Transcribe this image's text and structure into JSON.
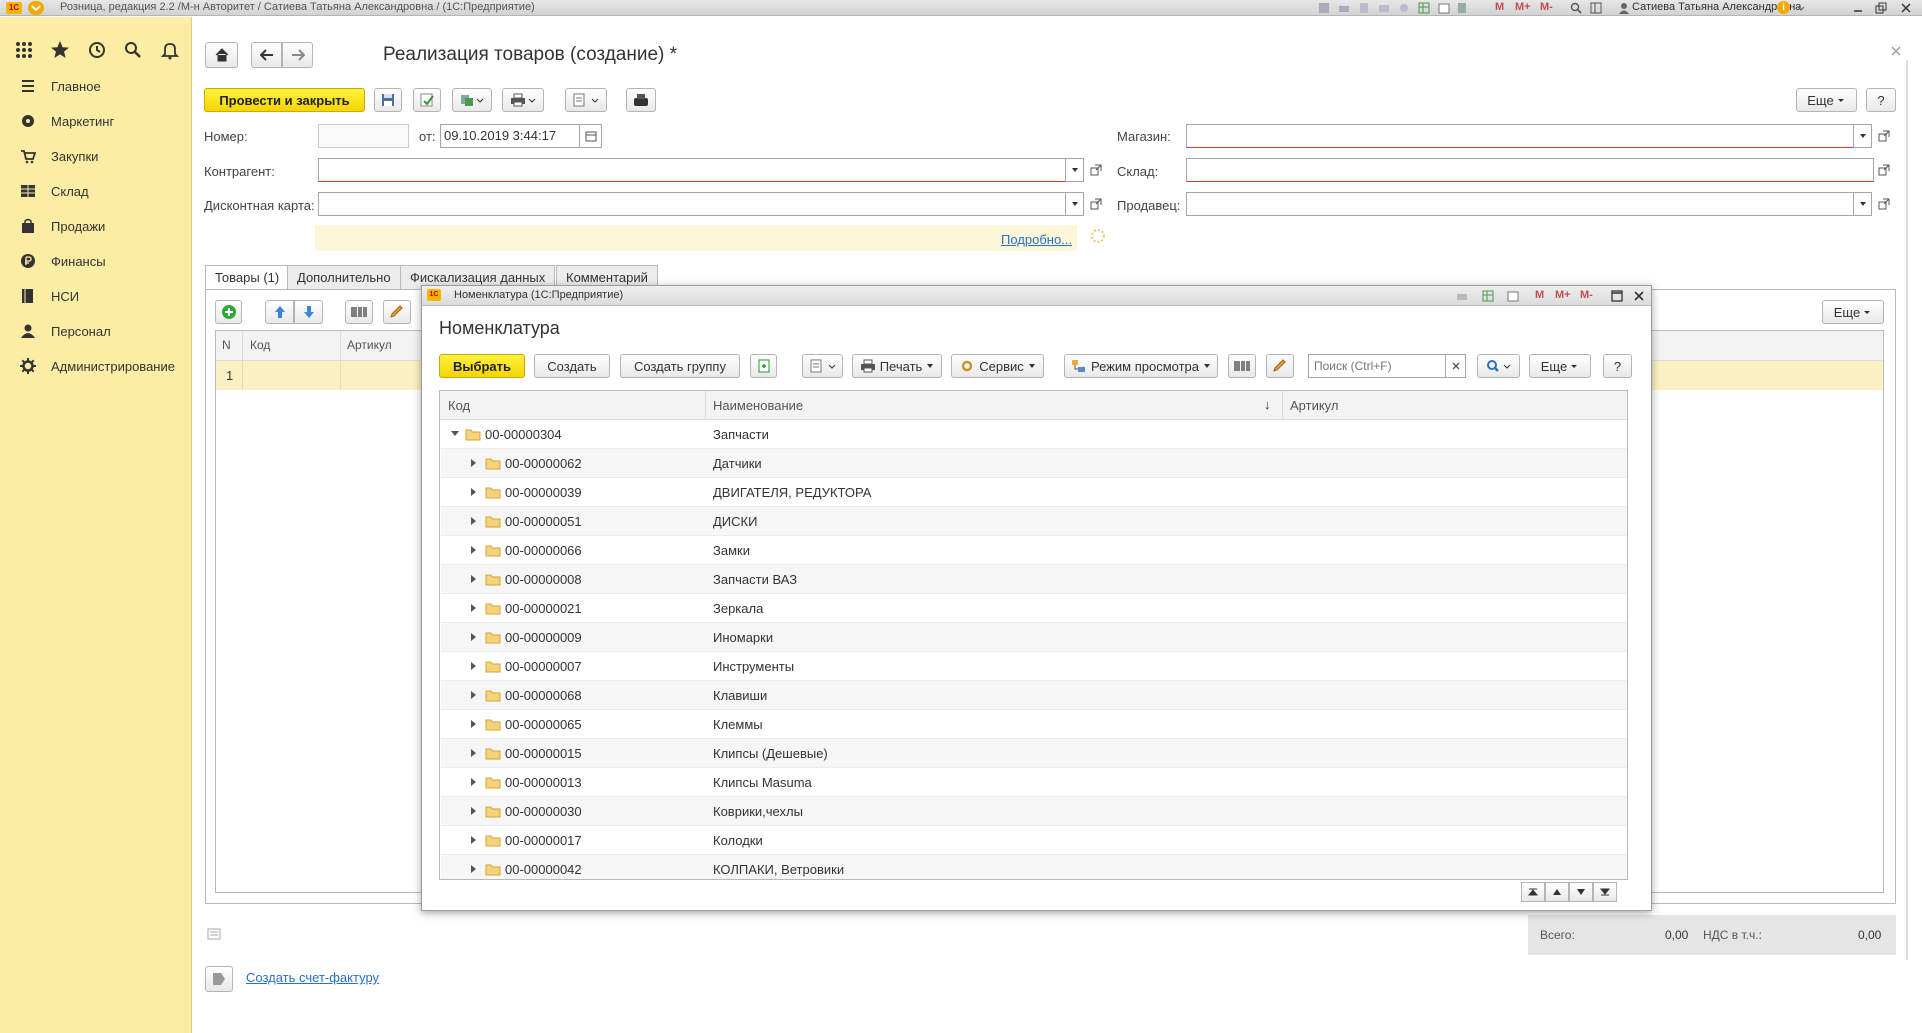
{
  "window": {
    "title": "Розница, редакция 2.2 /М-н Авторитет / Сатиева Татьяна Александровна / (1С:Предприятие)",
    "user": "Сатиева Татьяна Александровна",
    "mem_buttons": [
      "M",
      "M+",
      "M-"
    ]
  },
  "sections": [
    {
      "label": "Главное",
      "icon": "menu-icon"
    },
    {
      "label": "Маркетинг",
      "icon": "marketing-icon"
    },
    {
      "label": "Закупки",
      "icon": "purchases-icon"
    },
    {
      "label": "Склад",
      "icon": "warehouse-icon"
    },
    {
      "label": "Продажи",
      "icon": "sales-icon"
    },
    {
      "label": "Финансы",
      "icon": "finance-icon"
    },
    {
      "label": "НСИ",
      "icon": "reference-data-icon"
    },
    {
      "label": "Персонал",
      "icon": "personnel-icon"
    },
    {
      "label": "Администрирование",
      "icon": "gear-icon"
    }
  ],
  "doc": {
    "title": "Реализация товаров (создание) *",
    "post_close": "Провести и закрыть",
    "more": "Еще",
    "help": "?",
    "number_label": "Номер:",
    "number_value": "",
    "from_label": "от:",
    "date_value": "09.10.2019  3:44:17",
    "counterparty_label": "Контрагент:",
    "discount_label": "Дисконтная карта:",
    "shop_label": "Магазин:",
    "warehouse_label": "Склад:",
    "seller_label": "Продавец:",
    "details_link": "Подробно...",
    "tabs": [
      "Товары (1)",
      "Дополнительно",
      "Фискализация данных",
      "Комментарий"
    ],
    "table_more": "Еще",
    "columns": [
      "N",
      "Код",
      "Артикул"
    ],
    "row": {
      "n": "1",
      "code": "",
      "article": ""
    },
    "totals": {
      "total_label": "Всего:",
      "total_value": "0,00",
      "vat_label": "НДС в т.ч.:",
      "vat_value": "0,00"
    },
    "invoice_link": "Создать счет-фактуру"
  },
  "modal": {
    "window_title": "Номенклатура  (1С:Предприятие)",
    "heading": "Номенклатура",
    "select": "Выбрать",
    "create": "Создать",
    "create_group": "Создать группу",
    "print": "Печать",
    "service": "Сервис",
    "view_mode": "Режим просмотра",
    "search_placeholder": "Поиск (Ctrl+F)",
    "more": "Еще",
    "help": "?",
    "columns": {
      "code": "Код",
      "name": "Наименование",
      "sort_arrow": "↓",
      "article": "Артикул"
    },
    "root": {
      "code": "00-00000304",
      "name": "Запчасти"
    },
    "rows": [
      {
        "code": "00-00000062",
        "name": "Датчики"
      },
      {
        "code": "00-00000039",
        "name": "ДВИГАТЕЛЯ, РЕДУКТОРА"
      },
      {
        "code": "00-00000051",
        "name": "ДИСКИ"
      },
      {
        "code": "00-00000066",
        "name": "Замки"
      },
      {
        "code": "00-00000008",
        "name": "Запчасти ВАЗ"
      },
      {
        "code": "00-00000021",
        "name": "Зеркала"
      },
      {
        "code": "00-00000009",
        "name": "Иномарки"
      },
      {
        "code": "00-00000007",
        "name": "Инструменты"
      },
      {
        "code": "00-00000068",
        "name": "Клавиши"
      },
      {
        "code": "00-00000065",
        "name": "Клеммы"
      },
      {
        "code": "00-00000015",
        "name": "Клипсы (Дешевые)"
      },
      {
        "code": "00-00000013",
        "name": "Клипсы Masuma"
      },
      {
        "code": "00-00000030",
        "name": "Коврики,чехлы"
      },
      {
        "code": "00-00000017",
        "name": "Колодки"
      },
      {
        "code": "00-00000042",
        "name": "КОЛПАКИ, Ветровики"
      }
    ]
  }
}
